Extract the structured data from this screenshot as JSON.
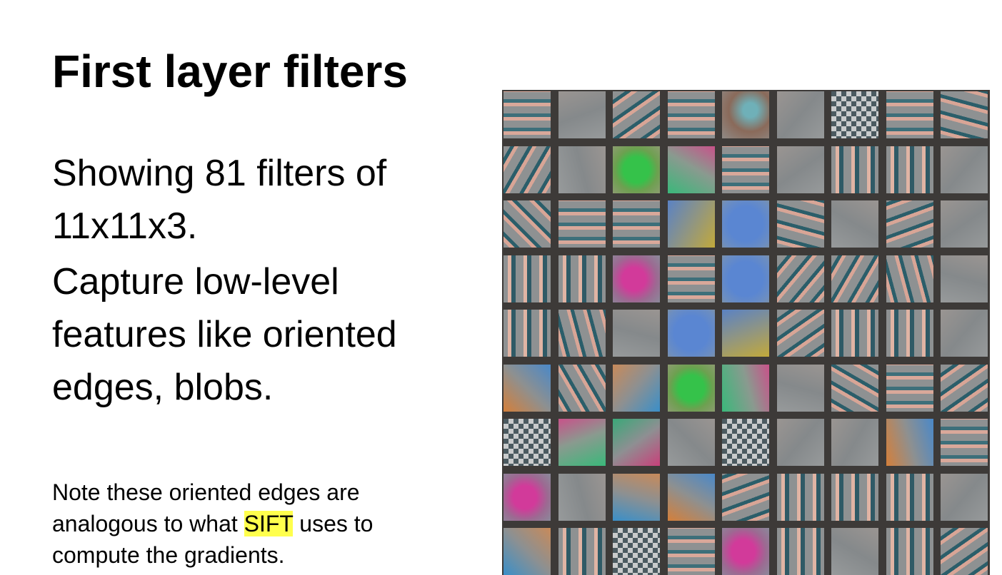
{
  "slide": {
    "title": "First layer filters",
    "body": {
      "line1": "Showing 81 filters of 11x11x3.",
      "line2": "Capture low-level features like oriented edges, blobs."
    },
    "note": {
      "before": "Note these oriented edges are analogous to what ",
      "highlight": "SIFT",
      "after": " uses to compute the gradients."
    }
  },
  "filter_grid": {
    "rows": 9,
    "cols": 9,
    "filters": [
      "stripes-h",
      "gray",
      "stripes-d",
      "stripes-h",
      "blob-brown",
      "gray",
      "checker",
      "stripes-h",
      "stripes-d",
      "stripes-d",
      "gray",
      "blob-green",
      "gradient-green",
      "stripes-h",
      "gray",
      "stripes-v",
      "stripes-v",
      "gray",
      "stripes-d",
      "stripes-h",
      "stripes-h",
      "gradient-yellow",
      "blob-blue",
      "stripes-d",
      "gray",
      "stripes-d",
      "gray",
      "stripes-v",
      "stripes-v",
      "blob-magenta",
      "stripes-h",
      "blob-blue",
      "stripes-d",
      "stripes-d",
      "stripes-d",
      "gray",
      "stripes-v",
      "stripes-d",
      "gray",
      "blob-blue",
      "gradient-yellow",
      "stripes-d",
      "stripes-v",
      "stripes-v",
      "gray",
      "gradient-orange",
      "stripes-d",
      "gradient-blue",
      "blob-green",
      "gradient-green",
      "gray",
      "stripes-d",
      "stripes-h",
      "stripes-d",
      "checker",
      "gradient-green",
      "gradient-magenta",
      "gray",
      "checker",
      "gray",
      "gray",
      "gradient-orange",
      "stripes-h",
      "blob-magenta",
      "gray",
      "gradient-blue",
      "gradient-orange",
      "stripes-d",
      "stripes-v",
      "stripes-v",
      "stripes-v",
      "gray",
      "gradient-blue",
      "stripes-v",
      "checker",
      "stripes-h",
      "blob-magenta",
      "stripes-v",
      "gray",
      "stripes-v",
      "stripes-d"
    ]
  }
}
